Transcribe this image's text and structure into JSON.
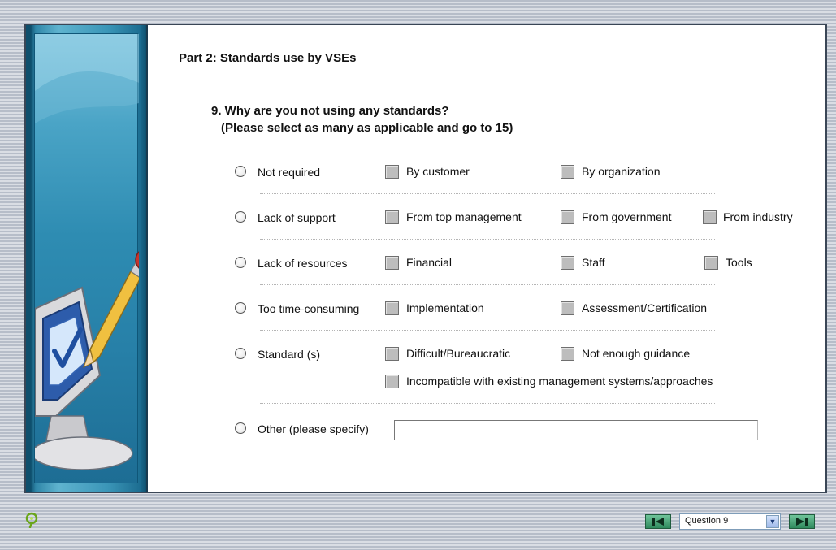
{
  "page": {
    "part_title": "Part 2: Standards use by VSEs",
    "question_line1": "9. Why are you not using any standards?",
    "question_line2": "(Please select as many as applicable and go to 15)"
  },
  "options": [
    {
      "label": "Not required",
      "checkboxes": [
        "By customer",
        "By organization"
      ]
    },
    {
      "label": "Lack of support",
      "checkboxes": [
        "From top management",
        "From government",
        "From industry"
      ]
    },
    {
      "label": "Lack of resources",
      "checkboxes": [
        "Financial",
        "Staff",
        "Tools"
      ]
    },
    {
      "label": "Too time-consuming",
      "checkboxes": [
        "Implementation",
        "Assessment/Certification"
      ]
    },
    {
      "label": "Standard (s)",
      "checkboxes": [
        "Difficult/Bureaucratic",
        "Not enough guidance",
        "Incompatible with existing management systems/approaches"
      ]
    },
    {
      "label": "Other (please specify)",
      "input_value": ""
    }
  ],
  "nav": {
    "prev_icon": "back-arrow-icon",
    "next_icon": "forward-arrow-icon",
    "question_select_value": "Question 9",
    "help_icon": "help-question-icon"
  },
  "colors": {
    "sidebar_dark": "#0e4f6d",
    "sidebar_light": "#5fb3cf",
    "nav_button": "#2f8a5e"
  }
}
